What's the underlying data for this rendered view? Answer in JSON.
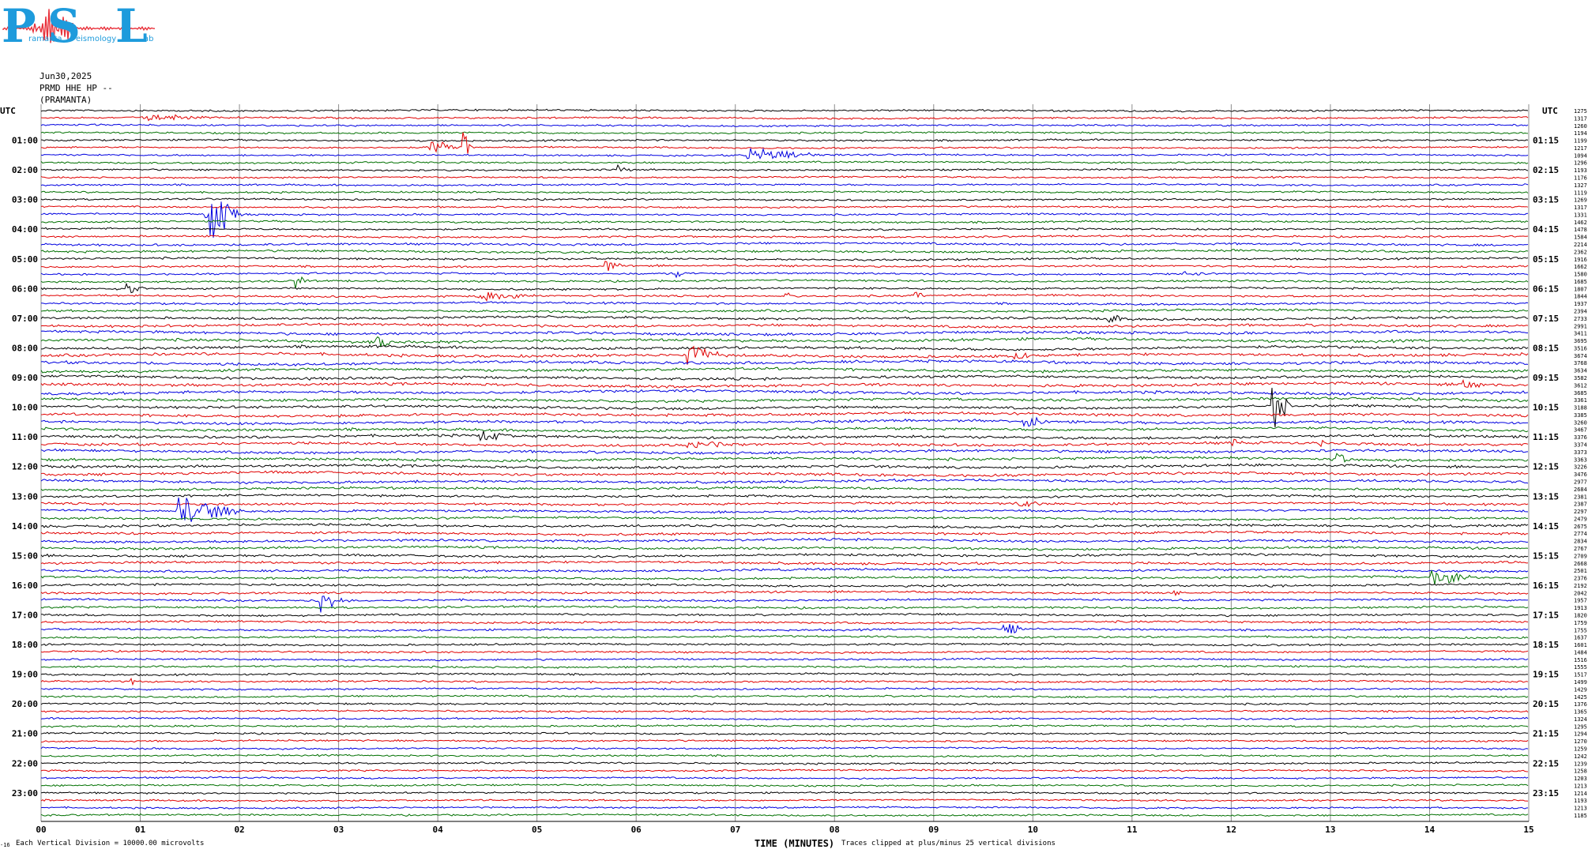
{
  "logo": {
    "letters": [
      "P",
      "S",
      "L"
    ],
    "words": [
      "ramanta",
      "eismology",
      "ab"
    ],
    "color": "#1e9bdc",
    "wave_color": "#e8303a"
  },
  "header": {
    "date": "Jun30,2025",
    "station": "PRMD HHE HP --",
    "location": "(PRAMANTA)"
  },
  "chart_data": {
    "type": "helicorder",
    "utc_label_left": "UTC",
    "utc_label_right": "UTC",
    "xlabel": "TIME (MINUTES)",
    "x_ticks": [
      "00",
      "01",
      "02",
      "03",
      "04",
      "05",
      "06",
      "07",
      "08",
      "09",
      "10",
      "11",
      "12",
      "13",
      "14",
      "15"
    ],
    "xlim": [
      0,
      15
    ],
    "minutes_per_line": 15,
    "left_hour_labels": [
      "01:00",
      "02:00",
      "03:00",
      "04:00",
      "05:00",
      "06:00",
      "07:00",
      "08:00",
      "09:00",
      "10:00",
      "11:00",
      "12:00",
      "13:00",
      "14:00",
      "15:00",
      "16:00",
      "17:00",
      "18:00",
      "19:00",
      "20:00",
      "21:00",
      "22:00",
      "23:00"
    ],
    "right_hour_labels": [
      "01:15",
      "02:15",
      "03:15",
      "04:15",
      "05:15",
      "06:15",
      "07:15",
      "08:15",
      "09:15",
      "10:15",
      "11:15",
      "12:15",
      "13:15",
      "14:15",
      "15:15",
      "16:15",
      "17:15",
      "18:15",
      "19:15",
      "20:15",
      "21:15",
      "22:15",
      "23:15"
    ],
    "trace_colors": [
      "#000000",
      "#e00000",
      "#0000e0",
      "#007000"
    ],
    "grid_color": "#8c8c8c",
    "line_counts": [
      "1275",
      "1317",
      "1260",
      "1194",
      "1199",
      "1217",
      "1094",
      "1296",
      "1193",
      "1176",
      "1327",
      "1119",
      "1269",
      "1317",
      "1331",
      "1462",
      "1478",
      "1584",
      "2214",
      "2362",
      "1916",
      "1662",
      "1580",
      "1685",
      "1807",
      "1844",
      "1937",
      "2394",
      "2733",
      "2991",
      "3411",
      "3695",
      "3516",
      "3674",
      "3768",
      "3634",
      "3582",
      "3612",
      "3685",
      "3361",
      "3188",
      "3385",
      "3260",
      "3467",
      "3376",
      "3374",
      "3373",
      "3363",
      "3226",
      "3476",
      "2977",
      "2684",
      "2381",
      "2387",
      "2297",
      "2479",
      "2675",
      "2774",
      "2834",
      "2767",
      "2709",
      "2668",
      "2501",
      "2376",
      "2192",
      "2042",
      "1957",
      "1913",
      "1820",
      "1759",
      "1755",
      "1637",
      "1601",
      "1484",
      "1516",
      "1555",
      "1517",
      "1499",
      "1429",
      "1425",
      "1376",
      "1365",
      "1324",
      "1295",
      "1294",
      "1270",
      "1259",
      "1242",
      "1239",
      "1258",
      "1203",
      "1213",
      "1214",
      "1193",
      "1213",
      "1185"
    ],
    "events": [
      {
        "line": 1,
        "minute": 1.0,
        "dur": 1.2,
        "amp": 0.5
      },
      {
        "line": 5,
        "minute": 3.9,
        "dur": 0.5,
        "amp": 1.2
      },
      {
        "line": 5,
        "minute": 4.25,
        "dur": 0.1,
        "amp": 3.5
      },
      {
        "line": 6,
        "minute": 7.1,
        "dur": 1.0,
        "amp": 1.3
      },
      {
        "line": 8,
        "minute": 5.8,
        "dur": 0.2,
        "amp": 0.7
      },
      {
        "line": 14,
        "minute": 1.65,
        "dur": 0.45,
        "amp": 5.0
      },
      {
        "line": 21,
        "minute": 5.65,
        "dur": 0.4,
        "amp": 0.8
      },
      {
        "line": 22,
        "minute": 6.4,
        "dur": 0.15,
        "amp": 0.9
      },
      {
        "line": 22,
        "minute": 11.5,
        "dur": 0.3,
        "amp": 0.6
      },
      {
        "line": 23,
        "minute": 2.55,
        "dur": 0.2,
        "amp": 1.2
      },
      {
        "line": 24,
        "minute": 0.85,
        "dur": 0.3,
        "amp": 0.9
      },
      {
        "line": 25,
        "minute": 4.4,
        "dur": 0.8,
        "amp": 0.8
      },
      {
        "line": 25,
        "minute": 7.5,
        "dur": 0.1,
        "amp": 0.8
      },
      {
        "line": 25,
        "minute": 8.8,
        "dur": 0.2,
        "amp": 0.8
      },
      {
        "line": 28,
        "minute": 10.75,
        "dur": 0.25,
        "amp": 1.1
      },
      {
        "line": 31,
        "minute": 3.35,
        "dur": 0.35,
        "amp": 1.3
      },
      {
        "line": 33,
        "minute": 6.5,
        "dur": 0.5,
        "amp": 1.8
      },
      {
        "line": 33,
        "minute": 9.8,
        "dur": 0.4,
        "amp": 0.5
      },
      {
        "line": 37,
        "minute": 14.3,
        "dur": 0.4,
        "amp": 0.8
      },
      {
        "line": 40,
        "minute": 12.4,
        "dur": 0.25,
        "amp": 4.5
      },
      {
        "line": 42,
        "minute": 9.9,
        "dur": 0.4,
        "amp": 1.0
      },
      {
        "line": 44,
        "minute": 4.4,
        "dur": 0.5,
        "amp": 0.9
      },
      {
        "line": 45,
        "minute": 6.5,
        "dur": 0.8,
        "amp": 0.5
      },
      {
        "line": 45,
        "minute": 12.0,
        "dur": 0.2,
        "amp": 0.8
      },
      {
        "line": 45,
        "minute": 12.9,
        "dur": 0.1,
        "amp": 0.6
      },
      {
        "line": 47,
        "minute": 13.05,
        "dur": 0.15,
        "amp": 1.6
      },
      {
        "line": 54,
        "minute": 1.35,
        "dur": 0.9,
        "amp": 2.2
      },
      {
        "line": 53,
        "minute": 9.85,
        "dur": 0.4,
        "amp": 0.5
      },
      {
        "line": 63,
        "minute": 14.0,
        "dur": 0.6,
        "amp": 1.6
      },
      {
        "line": 65,
        "minute": 11.4,
        "dur": 0.15,
        "amp": 0.6
      },
      {
        "line": 66,
        "minute": 2.8,
        "dur": 0.35,
        "amp": 1.8
      },
      {
        "line": 70,
        "minute": 9.7,
        "dur": 0.25,
        "amp": 1.8
      },
      {
        "line": 77,
        "minute": 0.9,
        "dur": 0.1,
        "amp": 0.6
      }
    ]
  },
  "footer": {
    "left_mark": "-16",
    "scale_note": "Each Vertical Division = 10000.00 microvolts",
    "clip_note": "Traces clipped at plus/minus 25 vertical divisions"
  }
}
